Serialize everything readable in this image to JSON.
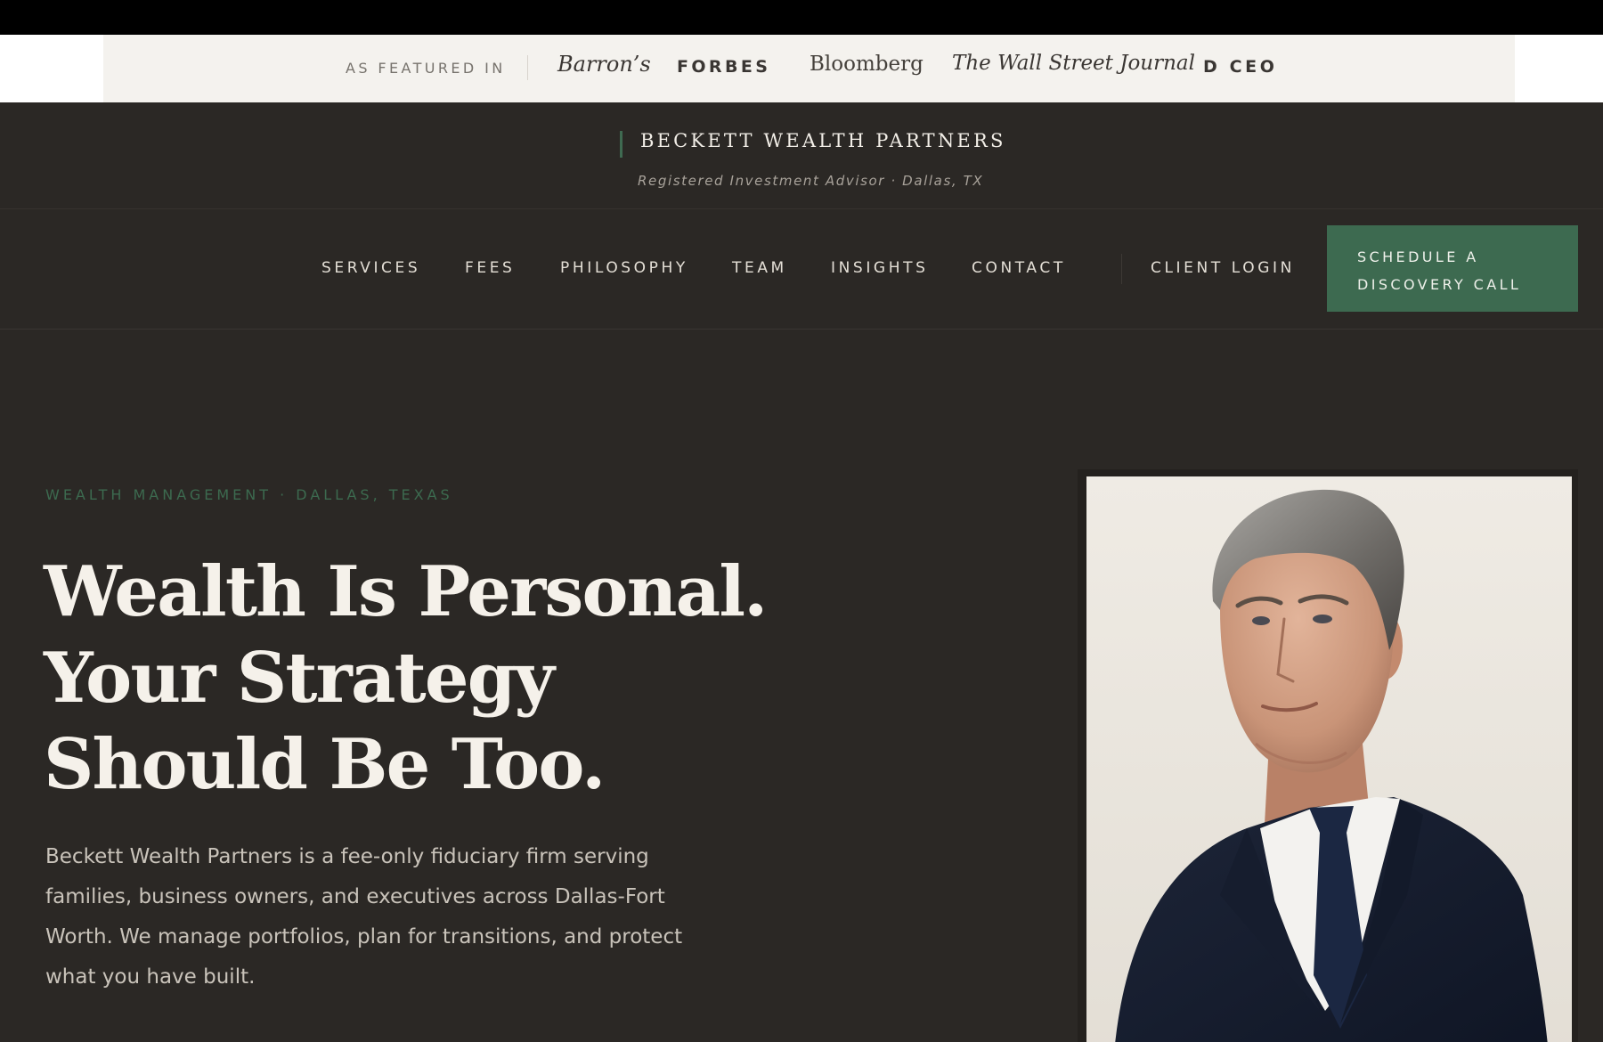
{
  "featured": {
    "label": "AS FEATURED IN",
    "logos": [
      "Barron’s",
      "FORBES",
      "Bloomberg",
      "The Wall Street Journal",
      "D CEO"
    ]
  },
  "brand": {
    "name": "BECKETT WEALTH PARTNERS",
    "subtitle": "Registered Investment Advisor · Dallas, TX"
  },
  "nav": {
    "items": [
      "SERVICES",
      "FEES",
      "PHILOSOPHY",
      "TEAM",
      "INSIGHTS",
      "CONTACT"
    ],
    "client_login": "CLIENT LOGIN",
    "cta_line1": "SCHEDULE A",
    "cta_line2": "DISCOVERY CALL"
  },
  "hero": {
    "eyebrow": "WEALTH MANAGEMENT · DALLAS, TEXAS",
    "headline": [
      "Wealth Is Personal.",
      "Your Strategy",
      "Should Be Too."
    ],
    "lede": "Beckett Wealth Partners is a fee-only fiduciary firm serving families, business owners, and executives across Dallas-Fort Worth. We manage portfolios, plan for transitions, and protect what you have built."
  },
  "colors": {
    "background": "#2b2825",
    "accent_green": "#3d6a50",
    "featured_band": "#f4f2ee"
  }
}
